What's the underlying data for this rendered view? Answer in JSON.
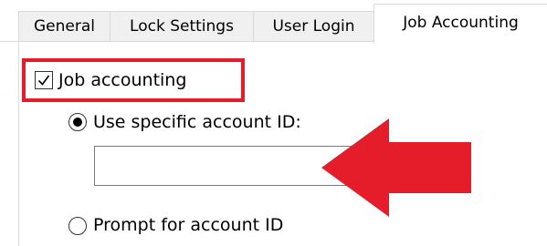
{
  "tabs": [
    {
      "label": "General",
      "active": false
    },
    {
      "label": "Lock Settings",
      "active": false
    },
    {
      "label": "User Login",
      "active": false
    },
    {
      "label": "Job Accounting",
      "active": true
    }
  ],
  "job_accounting": {
    "checkbox_label": "Job accounting",
    "checked": true
  },
  "options": {
    "specific_label": "Use specific account ID:",
    "specific_selected": true,
    "account_id_value": "",
    "prompt_label": "Prompt for account ID",
    "prompt_selected": false
  },
  "colors": {
    "highlight": "#e51d2b",
    "arrow": "#e51d2b",
    "tab_border": "#d9d9d9"
  },
  "icons": {
    "annotation_arrow": "left-arrow-icon",
    "checkmark": "checkmark-icon"
  }
}
